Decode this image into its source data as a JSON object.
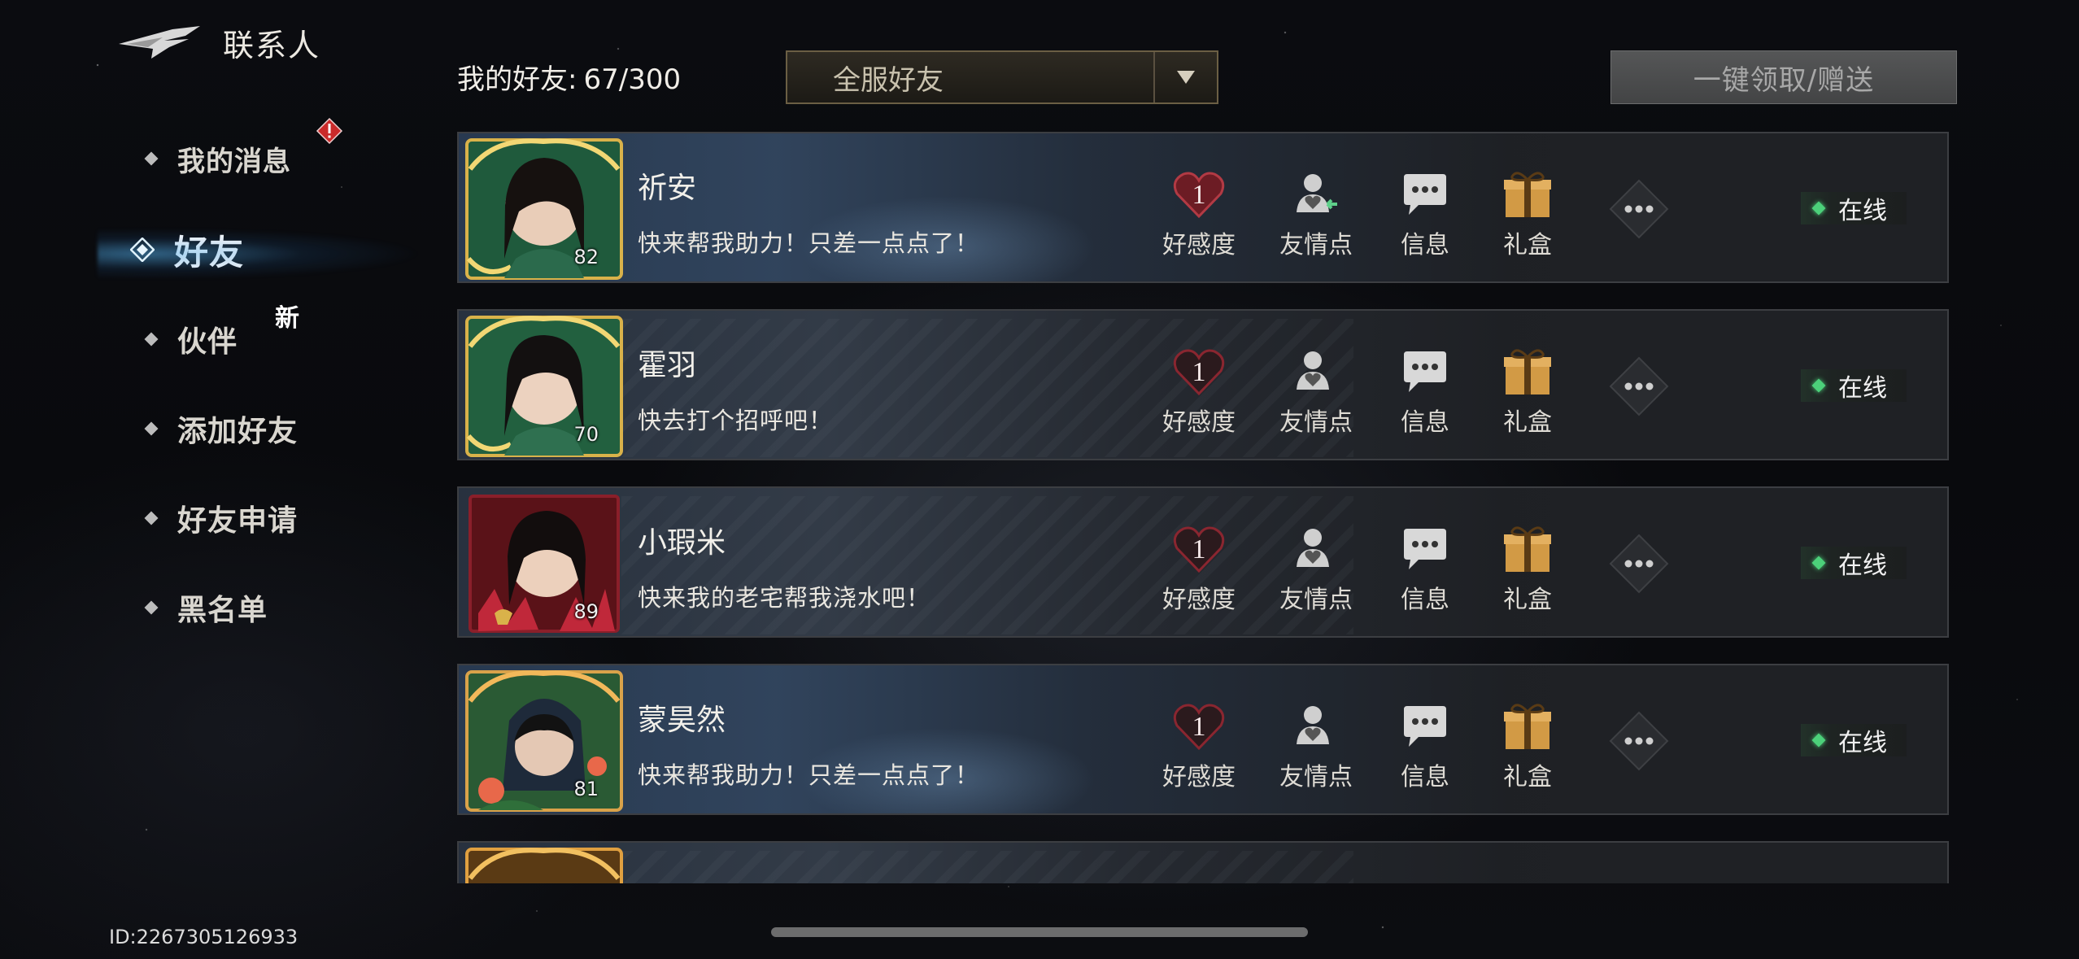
{
  "header": {
    "title": "联系人"
  },
  "sidebar": {
    "items": [
      {
        "label": "我的消息",
        "badge": "!"
      },
      {
        "label": "好友",
        "active": true
      },
      {
        "label": "伙伴",
        "tag": "新"
      },
      {
        "label": "添加好友"
      },
      {
        "label": "好友申请"
      },
      {
        "label": "黑名单"
      }
    ],
    "player_id": "ID:2267305126933"
  },
  "topbar": {
    "count_label": "我的好友:",
    "count_value": "67/300",
    "filter": {
      "selected": "全服好友"
    },
    "claim_button": "一键领取/赠送"
  },
  "friends": [
    {
      "name": "祈安",
      "level": "82",
      "status": "快来帮我助力！只差一点点了！",
      "affinity": "1",
      "online": "在线",
      "frame_color": "#2f7a52",
      "scene": "a"
    },
    {
      "name": "霍羽",
      "level": "70",
      "status": "快去打个招呼吧！",
      "affinity": "1",
      "online": "在线",
      "frame_color": "#2f7a52",
      "scene": "b"
    },
    {
      "name": "小瑕米",
      "level": "89",
      "status": "快来我的老宅帮我浇水吧！",
      "affinity": "1",
      "online": "在线",
      "frame_color": "#8a1f2a",
      "scene": "b"
    },
    {
      "name": "蒙昊然",
      "level": "81",
      "status": "快来帮我助力！只差一点点了！",
      "affinity": "1",
      "online": "在线",
      "frame_color": "#2f6a3a",
      "scene": "a"
    }
  ],
  "action_labels": {
    "affinity": "好感度",
    "friendship": "友情点",
    "message": "信息",
    "gift": "礼盒"
  },
  "icons": {
    "wing": "wing-emblem-icon",
    "affinity": "heart-icon",
    "friendship": "person-heart-icon",
    "message": "chat-bubble-icon",
    "gift": "gift-box-icon",
    "more": "more-dots-icon",
    "dropdown": "triangle-down-icon"
  },
  "colors": {
    "accent_gold": "#d8a24a",
    "online_green": "#4cd07a",
    "active_blue": "#4aa8e0",
    "heart_red": "#8a2630"
  }
}
